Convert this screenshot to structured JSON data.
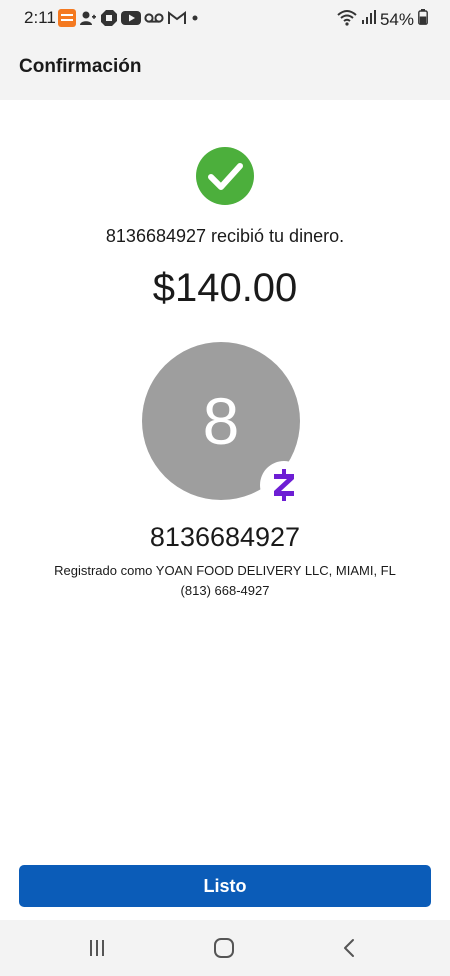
{
  "status_bar": {
    "time": "2:11",
    "battery": "54%",
    "icons": [
      "shopping-app-icon",
      "contacts-icon",
      "chase-icon",
      "youtube-icon",
      "voicemail-icon",
      "gmail-icon",
      "notification-dot-icon",
      "wifi-icon",
      "signal-icon",
      "battery-icon"
    ]
  },
  "header": {
    "title": "Confirmación"
  },
  "confirmation": {
    "message": "8136684927 recibió tu dinero.",
    "amount": "$140.00"
  },
  "recipient": {
    "avatar_letter": "8",
    "name": "8136684927",
    "registered_as": "Registrado como YOAN FOOD DELIVERY LLC, MIAMI, FL",
    "phone": "(813) 668-4927"
  },
  "actions": {
    "done_label": "Listo"
  },
  "colors": {
    "success_green": "#4caf3c",
    "zelle_purple": "#6d1ed4",
    "primary_blue": "#0b5cb8",
    "avatar_gray": "#9e9e9e"
  },
  "nav": {
    "icons": [
      "recent-apps-icon",
      "home-icon",
      "back-icon"
    ]
  }
}
